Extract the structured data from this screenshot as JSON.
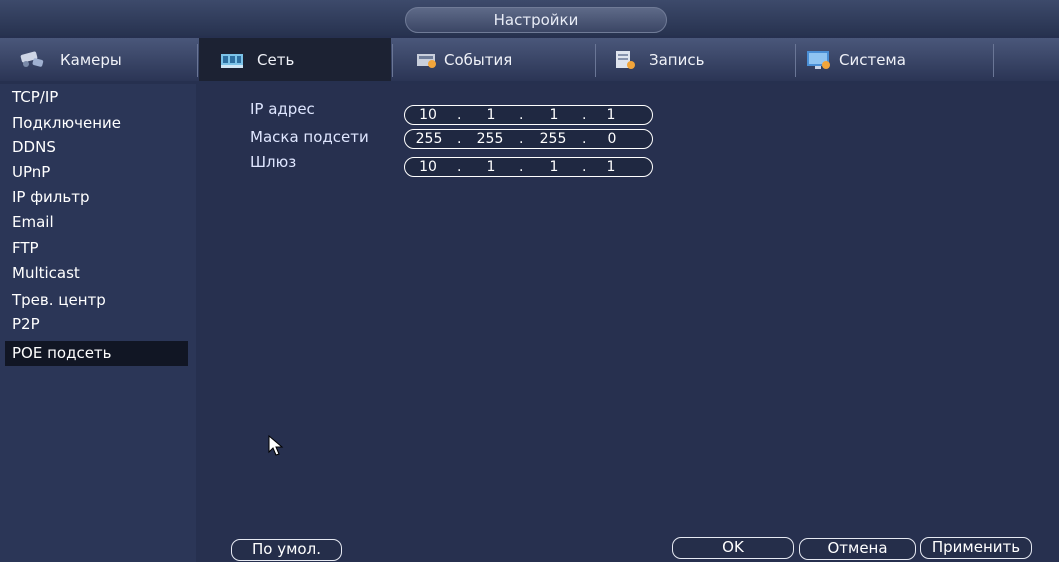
{
  "window": {
    "title": "Настройки"
  },
  "tabs": [
    {
      "label": "Камеры",
      "icon": "camera-icon"
    },
    {
      "label": "Сеть",
      "icon": "network-icon",
      "active": true
    },
    {
      "label": "События",
      "icon": "events-icon"
    },
    {
      "label": "Запись",
      "icon": "record-icon"
    },
    {
      "label": "Система",
      "icon": "system-icon"
    }
  ],
  "sidebar": {
    "items": [
      {
        "label": "TCP/IP"
      },
      {
        "label": "Подключение"
      },
      {
        "label": "DDNS"
      },
      {
        "label": "UPnP"
      },
      {
        "label": "IP фильтр"
      },
      {
        "label": "Email"
      },
      {
        "label": "FTP"
      },
      {
        "label": "Multicast"
      },
      {
        "label": "Трев. центр"
      },
      {
        "label": "P2P"
      },
      {
        "label": "POE подсеть",
        "selected": true
      }
    ]
  },
  "form": {
    "ip": {
      "label": "IP адрес",
      "octets": [
        "10",
        "1",
        "1",
        "1"
      ]
    },
    "mask": {
      "label": "Маска подсети",
      "octets": [
        "255",
        "255",
        "255",
        "0"
      ]
    },
    "gateway": {
      "label": "Шлюз",
      "octets": [
        "10",
        "1",
        "1",
        "1"
      ]
    }
  },
  "buttons": {
    "default": "По умол.",
    "ok": "OK",
    "cancel": "Отмена",
    "apply": "Применить"
  },
  "colors": {
    "background": "#26304f",
    "sidebar": "#2b3657",
    "selected": "#111624",
    "active_tab": "#1c2233"
  }
}
